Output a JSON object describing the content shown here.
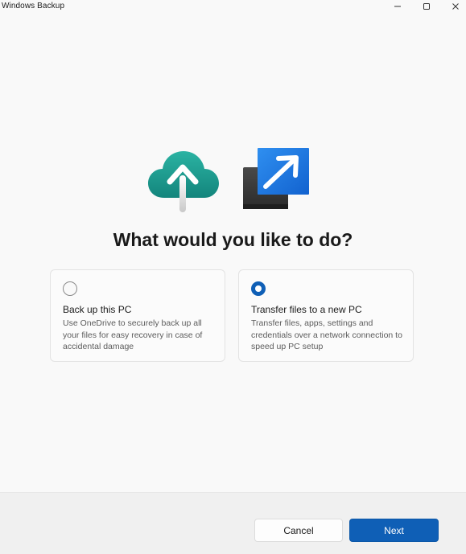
{
  "window": {
    "title": "Windows Backup"
  },
  "main": {
    "heading": "What would you like to do?",
    "options": [
      {
        "title": "Back up this PC",
        "description": "Use OneDrive to securely back up all your files for easy recovery in case of accidental damage",
        "selected": false
      },
      {
        "title": "Transfer files to a new PC",
        "description": "Transfer files, apps, settings and credentials over a network connection to speed up PC setup",
        "selected": true
      }
    ]
  },
  "footer": {
    "cancel_label": "Cancel",
    "next_label": "Next"
  },
  "icons": {
    "hero_left": "cloud-upload-icon",
    "hero_right": "transfer-arrow-icon",
    "minimize": "minimize-icon",
    "maximize": "maximize-icon",
    "close": "close-icon"
  },
  "colors": {
    "accent": "#0f5fb6",
    "cloud": "#1d9b8f",
    "window_bg": "#f9f9f9",
    "footer_bg": "#f0f0f0"
  }
}
